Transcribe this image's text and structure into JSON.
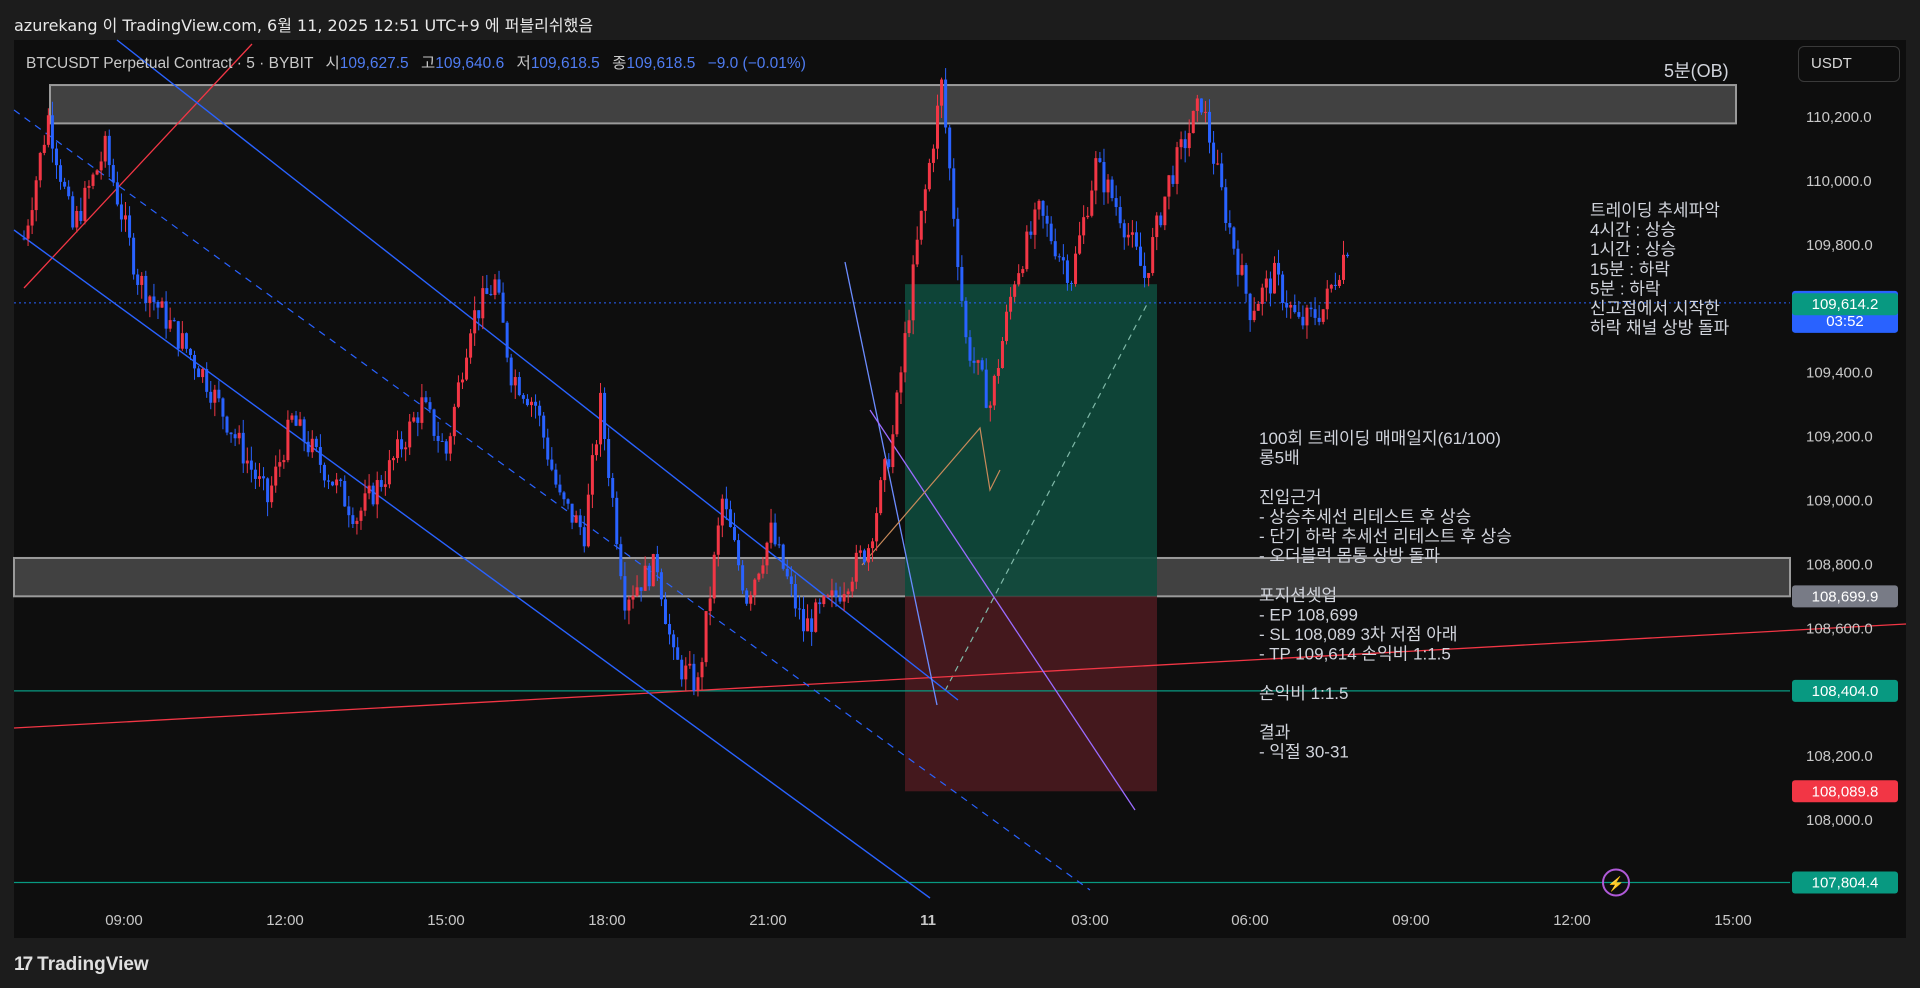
{
  "header": {
    "published": "azurekang 이 TradingView.com, 6월 11, 2025 12:51 UTC+9 에 퍼블리쉬했음"
  },
  "symbol_bar": {
    "symbol": "BTCUSDT Perpetual Contract · 5 · BYBIT",
    "open_label": "시",
    "open": "109,627.5",
    "high_label": "고",
    "high": "109,640.6",
    "low_label": "저",
    "low": "109,618.5",
    "close_label": "종",
    "close": "109,618.5",
    "change": "−9.0 (−0.01%)"
  },
  "currency_button": "USDT",
  "footer": {
    "logo_text": "TradingView"
  },
  "colors": {
    "background": "#0e0e0e",
    "up": "#f23645",
    "down": "#2962ff",
    "accent_teal": "#089981",
    "zone": "#d9d9d9"
  },
  "chart_data": {
    "type": "candlestick",
    "price_range": [
      107700,
      110500
    ],
    "y_ticks": [
      "110,200.0",
      "110,000.0",
      "109,800.0",
      "109,600.0",
      "109,400.0",
      "109,200.0",
      "109,000.0",
      "108,800.0",
      "108,600.0",
      "108,400.0",
      "108,200.0",
      "108,000.0"
    ],
    "x_ticks": [
      "09:00",
      "12:00",
      "15:00",
      "18:00",
      "21:00",
      "11",
      "03:00",
      "06:00",
      "09:00",
      "12:00",
      "15:00"
    ],
    "price_labels": [
      {
        "text": "109,618.5",
        "sub": "03:52",
        "price": 109618.5,
        "color": "#2962ff"
      },
      {
        "text": "109,614.2",
        "price": 109614.2,
        "color": "#089981"
      },
      {
        "text": "108,699.9",
        "price": 108699.9,
        "color": "#787b86"
      },
      {
        "text": "108,404.0",
        "price": 108404.0,
        "color": "#089981"
      },
      {
        "text": "108,089.8",
        "price": 108089.8,
        "color": "#f23645"
      },
      {
        "text": "107,804.4",
        "price": 107804.4,
        "color": "#089981"
      }
    ],
    "zones": [
      {
        "label": "5분(OB)",
        "top": 110300,
        "bottom": 110180
      },
      {
        "label": "",
        "top": 108820,
        "bottom": 108700
      }
    ],
    "position": {
      "entry": 108699.9,
      "target": 109614.2,
      "stop": 108089.8,
      "start_time": "10 22:30",
      "end_time": "11 04:20"
    },
    "candle_path": [
      [
        0,
        109820
      ],
      [
        6,
        110200
      ],
      [
        12,
        109850
      ],
      [
        20,
        110100
      ],
      [
        28,
        109700
      ],
      [
        36,
        109550
      ],
      [
        44,
        109400
      ],
      [
        52,
        109200
      ],
      [
        60,
        109000
      ],
      [
        66,
        109250
      ],
      [
        74,
        109100
      ],
      [
        82,
        108950
      ],
      [
        90,
        109100
      ],
      [
        98,
        109300
      ],
      [
        104,
        109150
      ],
      [
        110,
        109560
      ],
      [
        116,
        109680
      ],
      [
        120,
        109400
      ],
      [
        126,
        109300
      ],
      [
        132,
        109000
      ],
      [
        138,
        108900
      ],
      [
        142,
        109300
      ],
      [
        148,
        108700
      ],
      [
        156,
        108800
      ],
      [
        160,
        108500
      ],
      [
        166,
        108420
      ],
      [
        172,
        109000
      ],
      [
        178,
        108700
      ],
      [
        184,
        108900
      ],
      [
        192,
        108600
      ],
      [
        200,
        108700
      ],
      [
        208,
        108860
      ],
      [
        214,
        109200
      ],
      [
        220,
        109800
      ],
      [
        226,
        110300
      ],
      [
        232,
        109500
      ],
      [
        238,
        109300
      ],
      [
        244,
        109700
      ],
      [
        250,
        109900
      ],
      [
        258,
        109700
      ],
      [
        264,
        110050
      ],
      [
        270,
        109900
      ],
      [
        276,
        109700
      ],
      [
        282,
        110000
      ],
      [
        290,
        110250
      ],
      [
        296,
        109900
      ],
      [
        302,
        109600
      ],
      [
        308,
        109700
      ],
      [
        314,
        109550
      ],
      [
        320,
        109600
      ],
      [
        326,
        109800
      ]
    ],
    "annotations": [
      {
        "id": "trend",
        "lines": [
          "트레이딩 추세파악",
          "4시간 : 상승",
          "1시간 : 상승",
          "15분 : 하락",
          "5분 : 하락",
          "신고점에서 시작한",
          "하락 채널 상방 돌파"
        ]
      },
      {
        "id": "journal",
        "lines": [
          "100회 트레이딩 매매일지(61/100)",
          "롱5배",
          "",
          "진입근거",
          "- 상승추세선 리테스트 후 상승",
          "- 단기 하락 추세선 리테스트 후 상승",
          "- 오더블럭 몸통 상방 돌파",
          "",
          "포지션셋업",
          "- EP 108,699",
          "- SL 108,089 3차 저점 아래",
          "- TP 109,614 손익비 1:1.5",
          "",
          "손익비 1:1.5",
          "",
          "결과",
          "- 익절 30-31"
        ]
      }
    ],
    "grid": false,
    "legend": "none"
  }
}
